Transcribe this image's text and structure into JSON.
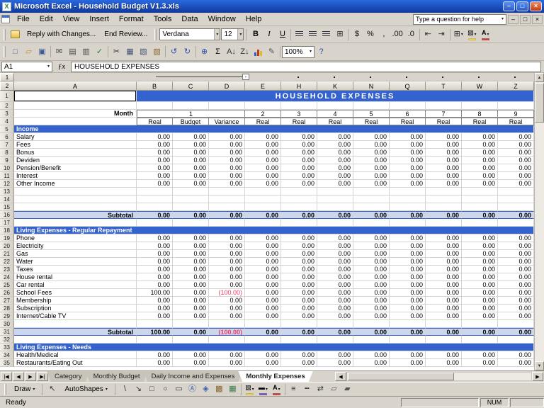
{
  "colors": {
    "band_blue": "#3462cf",
    "subtotal_fill": "#ccd7ee",
    "subtotal_border": "#3a62c4",
    "negative_red": "#f23b66",
    "chrome": "#d8d4cb",
    "grid_line": "#d4d4d4",
    "titlebar_top": "#2a69de",
    "titlebar_bottom": "#10389d"
  },
  "window": {
    "title": "Microsoft Excel - Household Budget V1.3.xls",
    "controls": {
      "minimize": "–",
      "restore": "□",
      "close": "×"
    }
  },
  "menu": {
    "items": [
      "File",
      "Edit",
      "View",
      "Insert",
      "Format",
      "Tools",
      "Data",
      "Window",
      "Help"
    ],
    "question_box": "Type a question for help"
  },
  "toolbars": {
    "review_buttons": [
      "Reply with Changes...",
      "End Review..."
    ],
    "formatting": {
      "font_name": "Verdana",
      "font_size": "12"
    },
    "standard": {
      "zoom": "100%"
    },
    "formatting_icons": [
      {
        "n": "bold",
        "g": "B",
        "b": 1
      },
      {
        "n": "italic",
        "g": "I",
        "i": 1
      },
      {
        "n": "underline",
        "g": "U",
        "u": 1
      },
      {
        "k": "sep"
      },
      {
        "n": "align-left",
        "k": "bars"
      },
      {
        "n": "align-center",
        "k": "bars"
      },
      {
        "n": "align-right",
        "k": "bars"
      },
      {
        "n": "merge-and-center",
        "g": "⊞",
        "c": "#333333"
      },
      {
        "k": "sep"
      },
      {
        "n": "currency-style",
        "g": "$",
        "c": "#111111"
      },
      {
        "n": "percent-style",
        "g": "%",
        "c": "#111111"
      },
      {
        "n": "comma-style",
        "g": ",",
        "c": "#111111"
      },
      {
        "n": "increase-decimal",
        "g": ".00",
        "c": "#111111"
      },
      {
        "n": "decrease-decimal",
        "g": ".0",
        "c": "#111111"
      },
      {
        "k": "sep"
      },
      {
        "n": "decrease-indent",
        "g": "⇤",
        "c": "#333333"
      },
      {
        "n": "increase-indent",
        "g": "⇥",
        "c": "#333333"
      },
      {
        "k": "sep"
      },
      {
        "n": "borders",
        "g": "⊞",
        "c": "#333333",
        "dd": 1
      },
      {
        "n": "fill-color",
        "g": "▨",
        "chip": "#ffd84a",
        "dd": 1
      },
      {
        "n": "font-color",
        "g": "A",
        "b": 1,
        "chip": "#d83a3a",
        "dd": 1
      }
    ],
    "standard_icons": [
      {
        "n": "new-workbook",
        "g": "□",
        "c": "#50618c"
      },
      {
        "n": "open",
        "g": "▱",
        "c": "#b8922f"
      },
      {
        "n": "save",
        "g": "▣",
        "c": "#3c5a96"
      },
      {
        "k": "sep"
      },
      {
        "n": "email",
        "g": "✉",
        "c": "#4a4a4a"
      },
      {
        "n": "print",
        "g": "▤",
        "c": "#4a4a4a"
      },
      {
        "n": "print-preview",
        "g": "▥",
        "c": "#4a4a4a"
      },
      {
        "n": "spelling",
        "g": "✓",
        "c": "#1f7a2e"
      },
      {
        "k": "sep"
      },
      {
        "n": "cut",
        "g": "✂",
        "c": "#333333"
      },
      {
        "n": "copy",
        "g": "▦",
        "c": "#445577"
      },
      {
        "n": "paste",
        "g": "▧",
        "c": "#445577"
      },
      {
        "n": "format-painter",
        "g": "▨",
        "c": "#8a6a2f"
      },
      {
        "k": "sep"
      },
      {
        "n": "undo",
        "g": "↺",
        "c": "#2b4fae"
      },
      {
        "n": "redo",
        "g": "↻",
        "c": "#2b4fae"
      },
      {
        "k": "sep"
      },
      {
        "n": "insert-hyperlink",
        "g": "⊕",
        "c": "#2b4fae"
      },
      {
        "n": "autosum",
        "g": "Σ",
        "c": "#111111"
      },
      {
        "n": "sort-ascending",
        "g": "A↓",
        "c": "#333333"
      },
      {
        "n": "sort-descending",
        "g": "Z↓",
        "c": "#333333"
      },
      {
        "n": "chart-wizard",
        "k": "chart"
      },
      {
        "n": "drawing",
        "g": "✎",
        "c": "#555555"
      },
      {
        "k": "sep"
      },
      {
        "n": "zoom",
        "k": "zoom"
      },
      {
        "n": "help",
        "g": "?",
        "c": "#2b4fae"
      }
    ]
  },
  "formula_bar": {
    "name_box": "A1",
    "fx_label": "ƒx",
    "content": "HOUSEHOLD EXPENSES"
  },
  "sheet": {
    "outline_levels": [
      "1",
      "2"
    ],
    "columns": [
      "A",
      "B",
      "C",
      "D",
      "E",
      "H",
      "K",
      "N",
      "Q",
      "T",
      "W",
      "Z"
    ],
    "rows": [
      {
        "n": 1,
        "type": "title",
        "text": "HOUSEHOLD EXPENSES"
      },
      {
        "n": 2,
        "type": "blank"
      },
      {
        "n": 3,
        "type": "months",
        "label": "Month",
        "values": [
          "1",
          "2",
          "3",
          "4",
          "5",
          "6",
          "7",
          "8",
          "9"
        ]
      },
      {
        "n": 4,
        "type": "colhead",
        "values": [
          "Real",
          "Budget",
          "Variance",
          "Real",
          "Real",
          "Real",
          "Real",
          "Real",
          "Real",
          "Real",
          "Real"
        ]
      },
      {
        "n": 5,
        "type": "section",
        "label": "Income"
      },
      {
        "n": 6,
        "type": "data",
        "label": "Salary",
        "values": [
          "0.00",
          "0.00",
          "0.00",
          "0.00",
          "0.00",
          "0.00",
          "0.00",
          "0.00",
          "0.00",
          "0.00",
          "0.00"
        ]
      },
      {
        "n": 7,
        "type": "data",
        "label": "Fees",
        "values": [
          "0.00",
          "0.00",
          "0.00",
          "0.00",
          "0.00",
          "0.00",
          "0.00",
          "0.00",
          "0.00",
          "0.00",
          "0.00"
        ]
      },
      {
        "n": 8,
        "type": "data",
        "label": "Bonus",
        "values": [
          "0.00",
          "0.00",
          "0.00",
          "0.00",
          "0.00",
          "0.00",
          "0.00",
          "0.00",
          "0.00",
          "0.00",
          "0.00"
        ]
      },
      {
        "n": 9,
        "type": "data",
        "label": "Deviden",
        "values": [
          "0.00",
          "0.00",
          "0.00",
          "0.00",
          "0.00",
          "0.00",
          "0.00",
          "0.00",
          "0.00",
          "0.00",
          "0.00"
        ]
      },
      {
        "n": 10,
        "type": "data",
        "label": "Pension/Benefit",
        "values": [
          "0.00",
          "0.00",
          "0.00",
          "0.00",
          "0.00",
          "0.00",
          "0.00",
          "0.00",
          "0.00",
          "0.00",
          "0.00"
        ]
      },
      {
        "n": 11,
        "type": "data",
        "label": "Interest",
        "values": [
          "0.00",
          "0.00",
          "0.00",
          "0.00",
          "0.00",
          "0.00",
          "0.00",
          "0.00",
          "0.00",
          "0.00",
          "0.00"
        ]
      },
      {
        "n": 12,
        "type": "data",
        "label": "Other Income",
        "values": [
          "0.00",
          "0.00",
          "0.00",
          "0.00",
          "0.00",
          "0.00",
          "0.00",
          "0.00",
          "0.00",
          "0.00",
          "0.00"
        ]
      },
      {
        "n": 13,
        "type": "blank"
      },
      {
        "n": 14,
        "type": "blank"
      },
      {
        "n": 15,
        "type": "blank"
      },
      {
        "n": 16,
        "type": "subtotal",
        "label": "Subtotal",
        "values": [
          "0.00",
          "0.00",
          "0.00",
          "0.00",
          "0.00",
          "0.00",
          "0.00",
          "0.00",
          "0.00",
          "0.00",
          "0.00"
        ]
      },
      {
        "n": 17,
        "type": "blank"
      },
      {
        "n": 18,
        "type": "section",
        "label": "Living Expenses - Regular Repayment"
      },
      {
        "n": 19,
        "type": "data",
        "label": "Phone",
        "values": [
          "0.00",
          "0.00",
          "0.00",
          "0.00",
          "0.00",
          "0.00",
          "0.00",
          "0.00",
          "0.00",
          "0.00",
          "0.00"
        ]
      },
      {
        "n": 20,
        "type": "data",
        "label": "Electricity",
        "values": [
          "0.00",
          "0.00",
          "0.00",
          "0.00",
          "0.00",
          "0.00",
          "0.00",
          "0.00",
          "0.00",
          "0.00",
          "0.00"
        ]
      },
      {
        "n": 21,
        "type": "data",
        "label": "Gas",
        "values": [
          "0.00",
          "0.00",
          "0.00",
          "0.00",
          "0.00",
          "0.00",
          "0.00",
          "0.00",
          "0.00",
          "0.00",
          "0.00"
        ]
      },
      {
        "n": 22,
        "type": "data",
        "label": "Water",
        "values": [
          "0.00",
          "0.00",
          "0.00",
          "0.00",
          "0.00",
          "0.00",
          "0.00",
          "0.00",
          "0.00",
          "0.00",
          "0.00"
        ]
      },
      {
        "n": 23,
        "type": "data",
        "label": "Taxes",
        "values": [
          "0.00",
          "0.00",
          "0.00",
          "0.00",
          "0.00",
          "0.00",
          "0.00",
          "0.00",
          "0.00",
          "0.00",
          "0.00"
        ]
      },
      {
        "n": 24,
        "type": "data",
        "label": "House rental",
        "values": [
          "0.00",
          "0.00",
          "0.00",
          "0.00",
          "0.00",
          "0.00",
          "0.00",
          "0.00",
          "0.00",
          "0.00",
          "0.00"
        ]
      },
      {
        "n": 25,
        "type": "data",
        "label": "Car rental",
        "values": [
          "0.00",
          "0.00",
          "0.00",
          "0.00",
          "0.00",
          "0.00",
          "0.00",
          "0.00",
          "0.00",
          "0.00",
          "0.00"
        ]
      },
      {
        "n": 26,
        "type": "data",
        "label": "School Fees",
        "values": [
          "100.00",
          "0.00",
          "(100.00)",
          "0.00",
          "0.00",
          "0.00",
          "0.00",
          "0.00",
          "0.00",
          "0.00",
          "0.00"
        ]
      },
      {
        "n": 27,
        "type": "data",
        "label": "Membership",
        "values": [
          "0.00",
          "0.00",
          "0.00",
          "0.00",
          "0.00",
          "0.00",
          "0.00",
          "0.00",
          "0.00",
          "0.00",
          "0.00"
        ]
      },
      {
        "n": 28,
        "type": "data",
        "label": "Subscription",
        "values": [
          "0.00",
          "0.00",
          "0.00",
          "0.00",
          "0.00",
          "0.00",
          "0.00",
          "0.00",
          "0.00",
          "0.00",
          "0.00"
        ]
      },
      {
        "n": 29,
        "type": "data",
        "label": "Internet/Cable TV",
        "values": [
          "0.00",
          "0.00",
          "0.00",
          "0.00",
          "0.00",
          "0.00",
          "0.00",
          "0.00",
          "0.00",
          "0.00",
          "0.00"
        ]
      },
      {
        "n": 30,
        "type": "blank"
      },
      {
        "n": 31,
        "type": "subtotal",
        "label": "Subtotal",
        "values": [
          "100.00",
          "0.00",
          "(100.00)",
          "0.00",
          "0.00",
          "0.00",
          "0.00",
          "0.00",
          "0.00",
          "0.00",
          "0.00"
        ]
      },
      {
        "n": 32,
        "type": "blank"
      },
      {
        "n": 33,
        "type": "section",
        "label": "Living Expenses - Needs"
      },
      {
        "n": 34,
        "type": "data",
        "label": "Health/Medical",
        "values": [
          "0.00",
          "0.00",
          "0.00",
          "0.00",
          "0.00",
          "0.00",
          "0.00",
          "0.00",
          "0.00",
          "0.00",
          "0.00"
        ]
      },
      {
        "n": 35,
        "type": "data",
        "label": "Restaurants/Eating Out",
        "values": [
          "0.00",
          "0.00",
          "0.00",
          "0.00",
          "0.00",
          "0.00",
          "0.00",
          "0.00",
          "0.00",
          "0.00",
          "0.00"
        ]
      }
    ]
  },
  "tabs": {
    "nav": [
      "|◀",
      "◀",
      "▶",
      "▶|"
    ],
    "items": [
      {
        "label": "Category",
        "active": false
      },
      {
        "label": "Monthly Budget",
        "active": false
      },
      {
        "label": "Daily Income and Expenses",
        "active": false
      },
      {
        "label": "Monthly Expenses",
        "active": true
      }
    ]
  },
  "drawbar": {
    "draw_label": "Draw",
    "autoshapes_label": "AutoShapes",
    "pointer": {
      "n": "select-objects",
      "g": "↖",
      "c": "#333333"
    },
    "icons": [
      {
        "n": "line",
        "g": "\\",
        "c": "#333333"
      },
      {
        "n": "arrow",
        "g": "↘",
        "c": "#333333"
      },
      {
        "n": "rectangle",
        "g": "□",
        "c": "#333333"
      },
      {
        "n": "oval",
        "g": "○",
        "c": "#333333"
      },
      {
        "n": "text-box",
        "g": "▭",
        "c": "#333333"
      },
      {
        "n": "wordart",
        "g": "Ⓐ",
        "c": "#3a5fae"
      },
      {
        "n": "diagram",
        "g": "◈",
        "c": "#3a5fae"
      },
      {
        "n": "clip-art",
        "g": "▩",
        "c": "#8a6a2f"
      },
      {
        "n": "picture",
        "g": "▦",
        "c": "#3a7a4a"
      },
      {
        "k": "sep"
      },
      {
        "n": "fill-color",
        "g": "▨",
        "chip": "#ffd84a",
        "dd": 1
      },
      {
        "n": "line-color",
        "g": "▬",
        "chip": "#7a52c8",
        "dd": 1
      },
      {
        "n": "font-color",
        "g": "A",
        "b": 1,
        "chip": "#d83a3a",
        "dd": 1
      },
      {
        "k": "sep"
      },
      {
        "n": "line-style",
        "g": "≡",
        "c": "#333333"
      },
      {
        "n": "dash-style",
        "g": "╍",
        "c": "#333333"
      },
      {
        "n": "arrow-style",
        "g": "⇄",
        "c": "#333333"
      },
      {
        "n": "shadow-style",
        "g": "▱",
        "c": "#555555"
      },
      {
        "n": "3d-style",
        "g": "▰",
        "c": "#555555"
      }
    ]
  },
  "status": {
    "ready": "Ready",
    "num": "NUM"
  }
}
